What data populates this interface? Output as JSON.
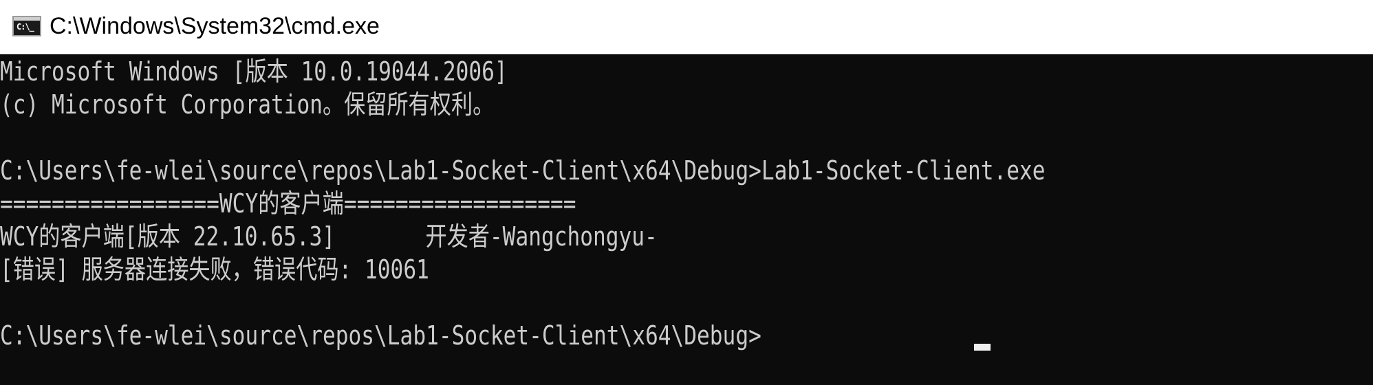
{
  "window": {
    "title": "C:\\Windows\\System32\\cmd.exe",
    "icon": "cmd-icon",
    "icon_glyph": "C:\\_"
  },
  "console": {
    "lines": [
      "Microsoft Windows [版本 10.0.19044.2006]",
      "(c) Microsoft Corporation。保留所有权利。",
      "",
      "C:\\Users\\fe-wlei\\source\\repos\\Lab1-Socket-Client\\x64\\Debug>Lab1-Socket-Client.exe",
      "=================WCY的客户端==================",
      "WCY的客户端[版本 22.10.65.3]       开发者-Wangchongyu-",
      "[错误] 服务器连接失败，错误代码: 10061",
      "",
      "C:\\Users\\fe-wlei\\source\\repos\\Lab1-Socket-Client\\x64\\Debug>"
    ]
  },
  "colors": {
    "console_background": "#0c0c0c",
    "console_text": "#cccccc",
    "titlebar_background": "#ffffff",
    "title_text": "#000000"
  }
}
